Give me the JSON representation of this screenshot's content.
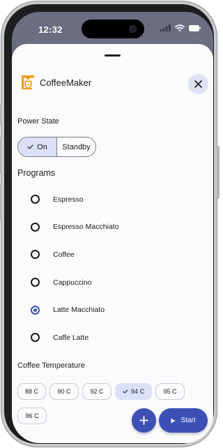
{
  "status_bar": {
    "time": "12:32"
  },
  "header": {
    "app_title": "CoffeeMaker",
    "close_label": "Close"
  },
  "power_state": {
    "label": "Power State",
    "options": [
      {
        "label": "On",
        "selected": true
      },
      {
        "label": "Standby",
        "selected": false
      }
    ]
  },
  "programs": {
    "label": "Programs",
    "items": [
      {
        "label": "Espresso",
        "selected": false
      },
      {
        "label": "Espresso Macchiato",
        "selected": false
      },
      {
        "label": "Coffee",
        "selected": false
      },
      {
        "label": "Cappuccino",
        "selected": false
      },
      {
        "label": "Latte Macchiato",
        "selected": true
      },
      {
        "label": "Caffe Latte",
        "selected": false
      }
    ]
  },
  "coffee_temperature": {
    "label": "Coffee Temperature",
    "options": [
      {
        "label": "88 C",
        "selected": false
      },
      {
        "label": "90 C",
        "selected": false
      },
      {
        "label": "92 C",
        "selected": false
      },
      {
        "label": "94 C",
        "selected": true
      },
      {
        "label": "95 C",
        "selected": false
      },
      {
        "label": "96 C",
        "selected": false
      }
    ]
  },
  "actions": {
    "add_icon": "plus-icon",
    "start_label": "Start",
    "start_icon": "play-icon"
  },
  "colors": {
    "primary": "#3c50b6",
    "selected_bg": "#dbe0f7",
    "app_icon": "#f29b1f"
  }
}
